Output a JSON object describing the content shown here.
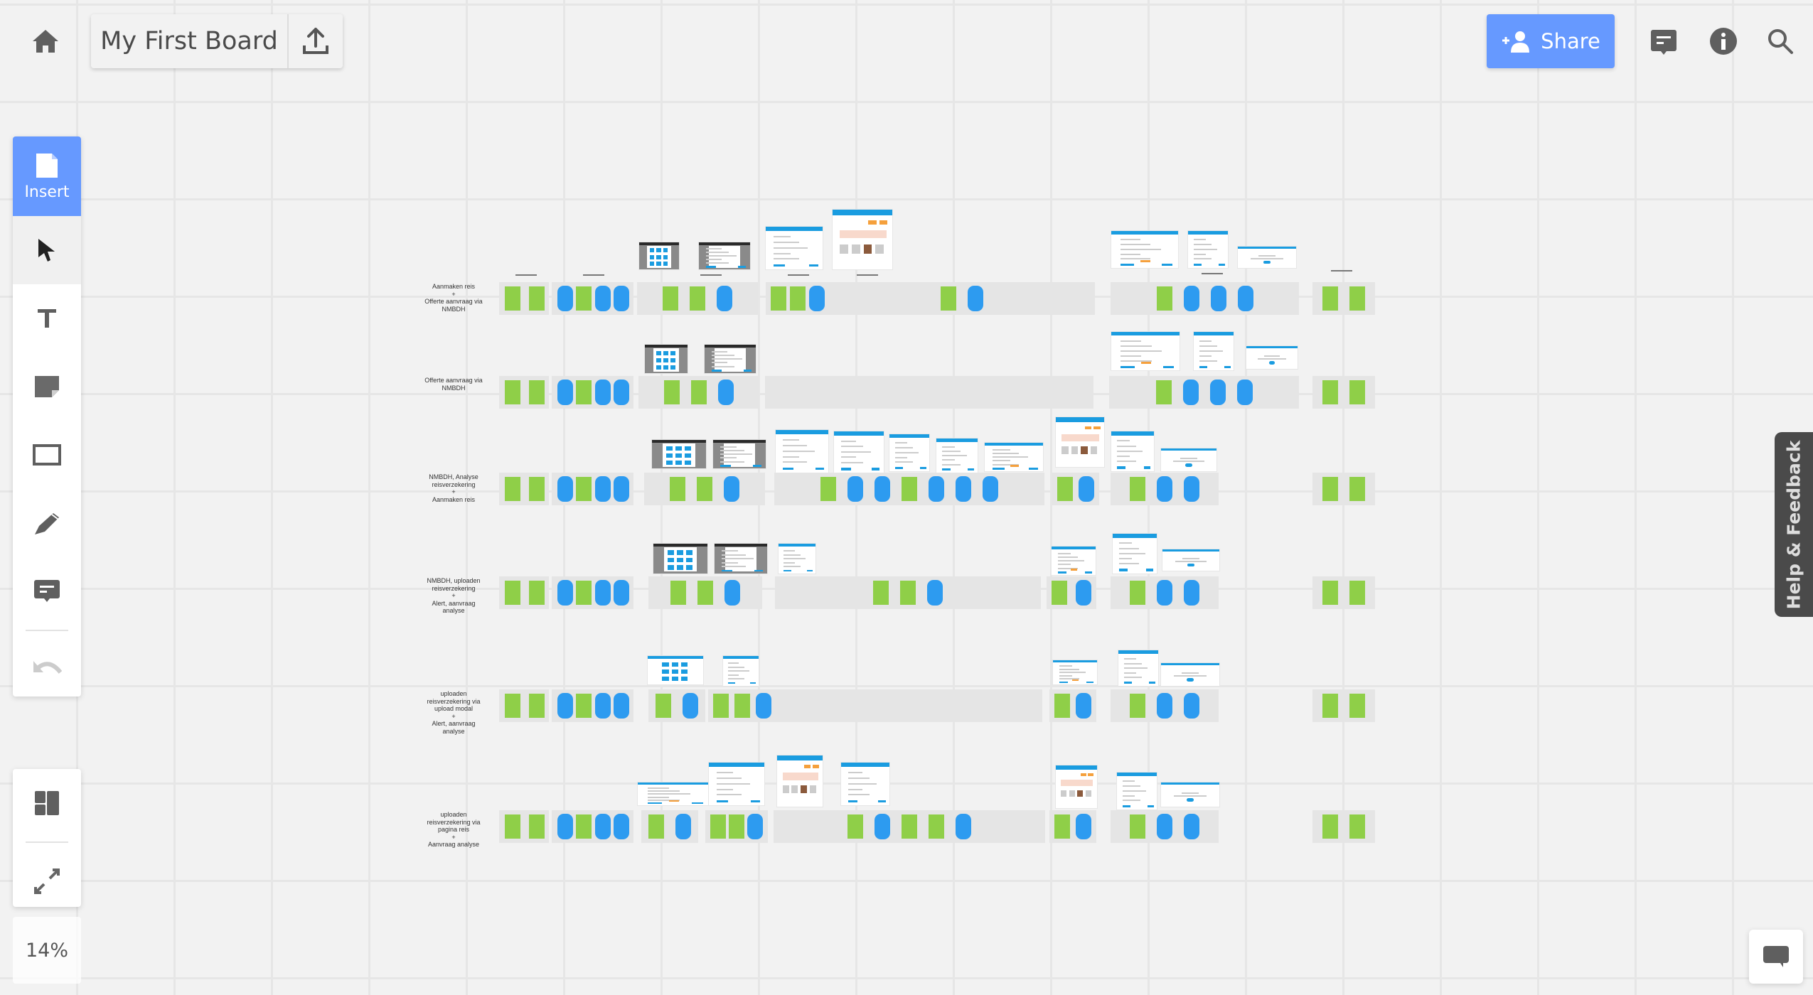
{
  "header": {
    "home_icon": "home-icon",
    "board_title": "My First Board",
    "export_icon": "upload-icon",
    "share_label": "Share",
    "share_icon": "add-user-icon",
    "comments_icon": "comment-icon",
    "info_icon": "info-icon",
    "search_icon": "search-icon"
  },
  "colors": {
    "accent": "#6699ff",
    "sticky_green": "#8fcf48",
    "sticky_blue": "#2d9bf0",
    "lane": "#e5e5e5",
    "canvas": "#f2f2f2"
  },
  "toolbar": {
    "insert_label": "Insert",
    "tools": [
      "select-tool",
      "text-tool",
      "sticky-note-tool",
      "shape-tool",
      "pen-tool",
      "comment-tool",
      "undo"
    ]
  },
  "bottom_tools": [
    "frames-panel",
    "fit-to-screen"
  ],
  "zoom_level": "14%",
  "help_feedback_label": "Help & Feedback",
  "chat_icon": "chat-icon",
  "board": {
    "rows": [
      {
        "label": "Aanmaken reis\n+\nOfferte aanvraag via\nNMBDH"
      },
      {
        "label": "Offerte aanvraag via\nNMBDH"
      },
      {
        "label": "NMBDH, Analyse\nreisverzekering\n+\nAanmaken reis"
      },
      {
        "label": "NMBDH, uploaden\nreisverzekering\n+\nAlert, aanvraag\nanalyse"
      },
      {
        "label": "uploaden\nreisverzekering via\nupload modal\n+\nAlert, aanvraag\nanalyse"
      },
      {
        "label": "uploaden\nreisverzekering via\npagina reis\n+\nAanvraag analyse"
      }
    ],
    "lanes": [
      [
        {
          "cards": "gg"
        },
        {
          "cards": "bgbb"
        },
        {
          "cards": "ggb"
        },
        {
          "cards": "ggb"
        },
        {
          "cards": "gb"
        },
        {
          "cards": "gbbb"
        },
        {
          "cards": "gg"
        }
      ],
      [
        {
          "cards": "gg"
        },
        {
          "cards": "bgbb"
        },
        {
          "cards": "ggb"
        },
        {
          "cards": ""
        },
        {
          "cards": "gbbb"
        },
        {
          "cards": "gg"
        }
      ],
      [
        {
          "cards": "gg"
        },
        {
          "cards": "bgbb"
        },
        {
          "cards": "ggb"
        },
        {
          "cards": "gbbgbbb"
        },
        {
          "cards": "gb"
        },
        {
          "cards": "gbb"
        },
        {
          "cards": "gg"
        }
      ],
      [
        {
          "cards": "gg"
        },
        {
          "cards": "bgbb"
        },
        {
          "cards": "ggb"
        },
        {
          "cards": "ggb"
        },
        {
          "cards": "gb"
        },
        {
          "cards": "gbb"
        },
        {
          "cards": "gg"
        }
      ],
      [
        {
          "cards": "gg"
        },
        {
          "cards": "bgbb"
        },
        {
          "cards": "gb"
        },
        {
          "cards": "ggb"
        },
        {
          "cards": ""
        },
        {
          "cards": "gb"
        },
        {
          "cards": "gbb"
        },
        {
          "cards": "gg"
        }
      ],
      [
        {
          "cards": "gg"
        },
        {
          "cards": "bgbb"
        },
        {
          "cards": "gb"
        },
        {
          "cards": "ggb"
        },
        {
          "cards": "gbggb"
        },
        {
          "cards": "gb"
        },
        {
          "cards": "gbb"
        },
        {
          "cards": "gg"
        }
      ]
    ],
    "screenshot_thumbnails": [
      [
        "dark-grid",
        "dark-form",
        "light-form",
        "product-page",
        "light-modal",
        "light-form",
        "light-dialog"
      ],
      [
        "dark-grid",
        "dark-form",
        "light-modal",
        "light-form",
        "light-dialog"
      ],
      [
        "dark-grid",
        "dark-form",
        "light-form",
        "light-form",
        "light-form",
        "light-form",
        "light-modal",
        "product-page",
        "light-form",
        "light-dialog"
      ],
      [
        "dark-grid",
        "dark-form",
        "light-form",
        "light-modal",
        "light-form",
        "light-dialog"
      ],
      [
        "light-grid",
        "light-form",
        "light-modal",
        "light-form",
        "light-dialog"
      ],
      [
        "light-modal",
        "light-form",
        "product-page",
        "light-form",
        "product-page",
        "light-form",
        "light-dialog"
      ]
    ]
  }
}
